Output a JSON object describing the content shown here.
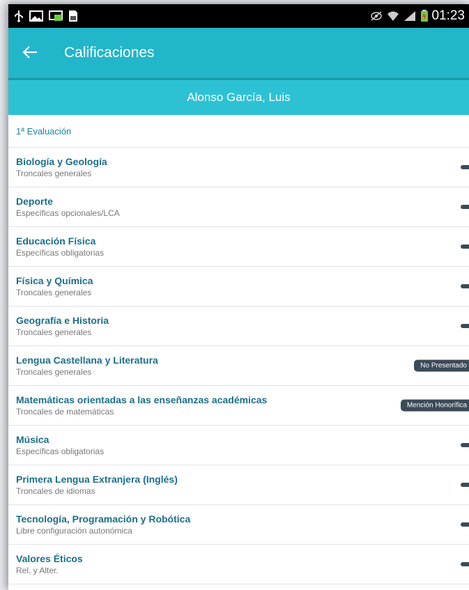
{
  "status_bar": {
    "time": "01:23",
    "left_icons": [
      "usb-icon",
      "image-icon",
      "cast-icon",
      "document-icon"
    ],
    "right_icons": [
      "eye-icon",
      "wifi-icon",
      "signal-icon",
      "battery-icon"
    ]
  },
  "app_bar": {
    "title": "Calificaciones"
  },
  "student": {
    "name": "Alonso García, Luis"
  },
  "evaluation": {
    "title": "1ª Evaluación"
  },
  "subjects": [
    {
      "name": "Biología y Geología",
      "category": "Troncales generales",
      "grade": ""
    },
    {
      "name": "Deporte",
      "category": "Específicas opcionales/LCA",
      "grade": ""
    },
    {
      "name": "Educación Física",
      "category": "Específicas obligatorias",
      "grade": ""
    },
    {
      "name": "Física y Química",
      "category": "Troncales generales",
      "grade": ""
    },
    {
      "name": "Geografía e Historia",
      "category": "Troncales generales",
      "grade": ""
    },
    {
      "name": "Lengua Castellana y Literatura",
      "category": "Troncales generales",
      "grade": "No Presentado"
    },
    {
      "name": "Matemáticas orientadas a las enseñanzas académicas",
      "category": "Troncales de matemáticas",
      "grade": "Mención Honorífica"
    },
    {
      "name": "Música",
      "category": "Específicas obligatorias",
      "grade": ""
    },
    {
      "name": "Primera Lengua Extranjera (Inglés)",
      "category": "Troncales de idiomas",
      "grade": ""
    },
    {
      "name": "Tecnología, Programación y Robótica",
      "category": "Libre configuración autonómica",
      "grade": ""
    },
    {
      "name": "Valores Éticos",
      "category": "Rel. y Alter.",
      "grade": ""
    }
  ],
  "colors": {
    "app_bar": "#21b6c9",
    "student_header": "#2cc2d4",
    "subject_name": "#1c6e8a",
    "grade_badge": "#3b4a57"
  }
}
